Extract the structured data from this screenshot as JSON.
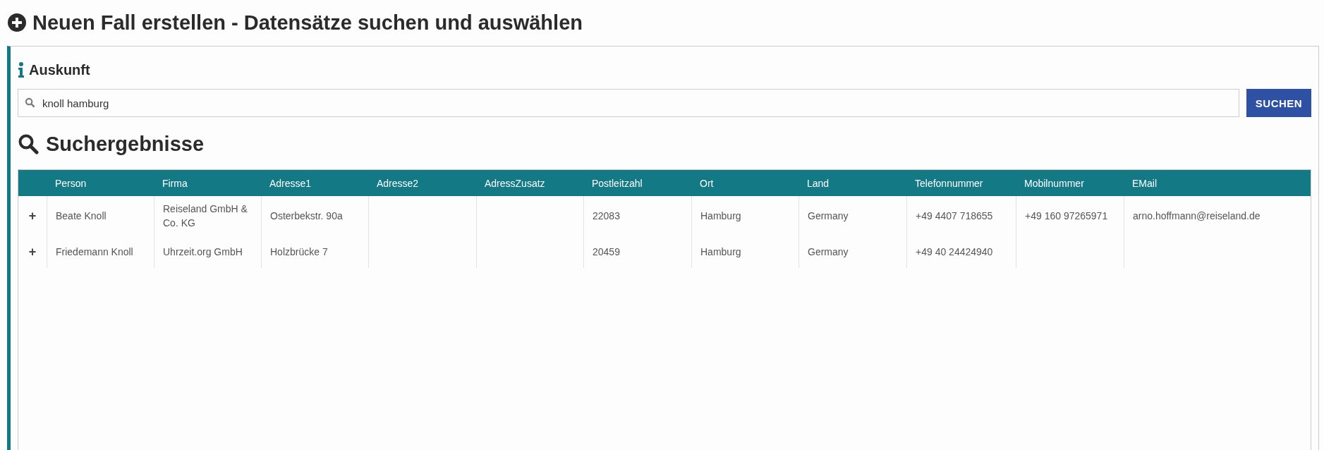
{
  "page_title": "Neuen Fall erstellen - Datensätze suchen und auswählen",
  "panel": {
    "title": "Auskunft",
    "search": {
      "value": "knoll hamburg"
    },
    "search_button": "SUCHEN"
  },
  "results": {
    "title": "Suchergebnisse",
    "table": {
      "columns": [
        "Person",
        "Firma",
        "Adresse1",
        "Adresse2",
        "AdressZusatz",
        "Postleitzahl",
        "Ort",
        "Land",
        "Telefonnummer",
        "Mobilnummer",
        "EMail"
      ],
      "rows": [
        {
          "expand": "+",
          "cells": [
            "Beate Knoll",
            "Reiseland GmbH & Co. KG",
            "Osterbekstr. 90a",
            "",
            "",
            "22083",
            "Hamburg",
            "Germany",
            "+49 4407 718655",
            "+49 160 97265971",
            "arno.hoffmann@reiseland.de"
          ]
        },
        {
          "expand": "+",
          "cells": [
            "Friedemann Knoll",
            "Uhrzeit.org GmbH",
            "Holzbrücke 7",
            "",
            "",
            "20459",
            "Hamburg",
            "Germany",
            "+49 40 24424940",
            "",
            ""
          ]
        }
      ]
    }
  }
}
